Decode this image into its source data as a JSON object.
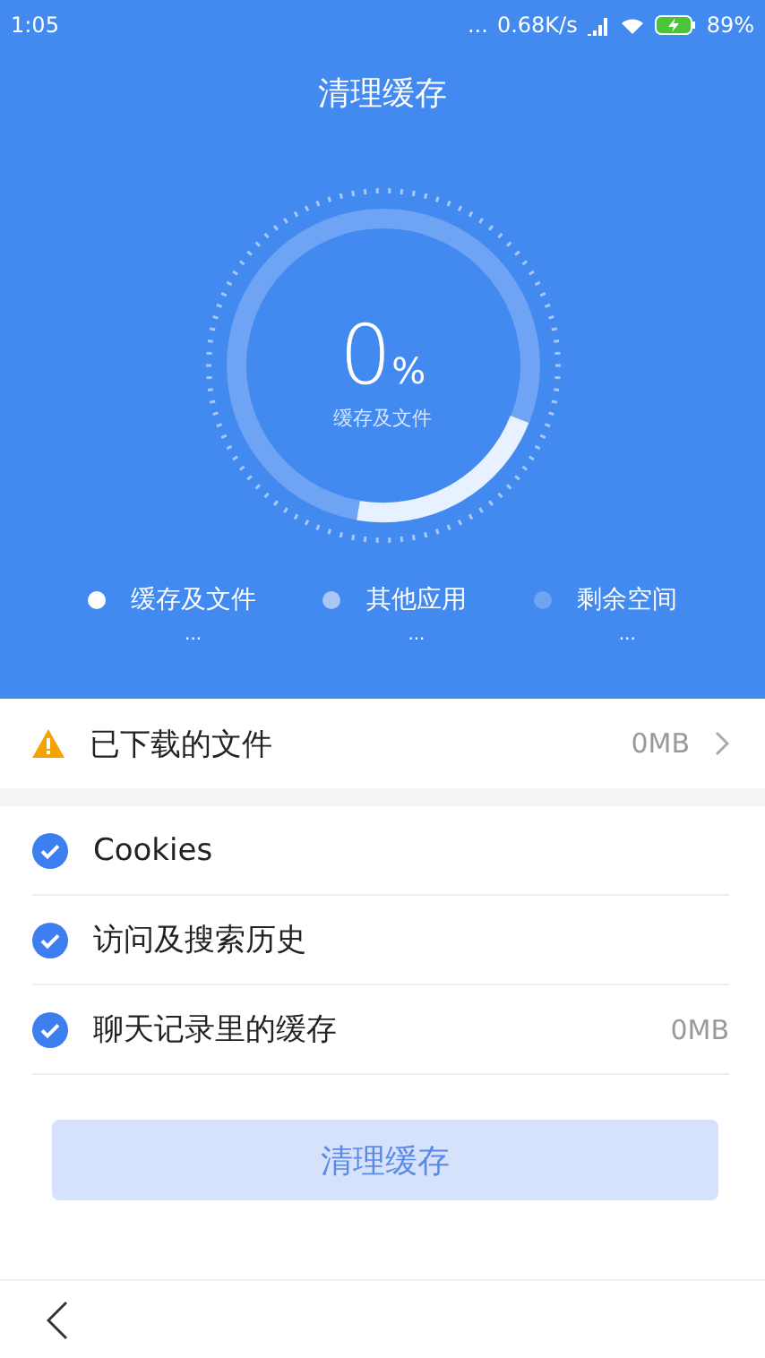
{
  "status_bar": {
    "time": "1:05",
    "dots": "...",
    "speed": "0.68K/s",
    "battery": "89%"
  },
  "title": "清理缓存",
  "gauge": {
    "value": "0",
    "unit": "%",
    "label": "缓存及文件"
  },
  "legend": [
    {
      "label": "缓存及文件",
      "value": "...",
      "color": "#ffffff"
    },
    {
      "label": "其他应用",
      "value": "...",
      "color": "#a9c8f8"
    },
    {
      "label": "剩余空间",
      "value": "...",
      "color": "#6fa3f3"
    }
  ],
  "downloads": {
    "label": "已下载的文件",
    "size": "0MB"
  },
  "items": [
    {
      "label": "Cookies",
      "checked": true
    },
    {
      "label": "访问及搜索历史",
      "checked": true
    },
    {
      "label": "聊天记录里的缓存",
      "size": "0MB",
      "checked": true
    }
  ],
  "clean_button": {
    "label": "清理缓存",
    "disabled": true
  }
}
